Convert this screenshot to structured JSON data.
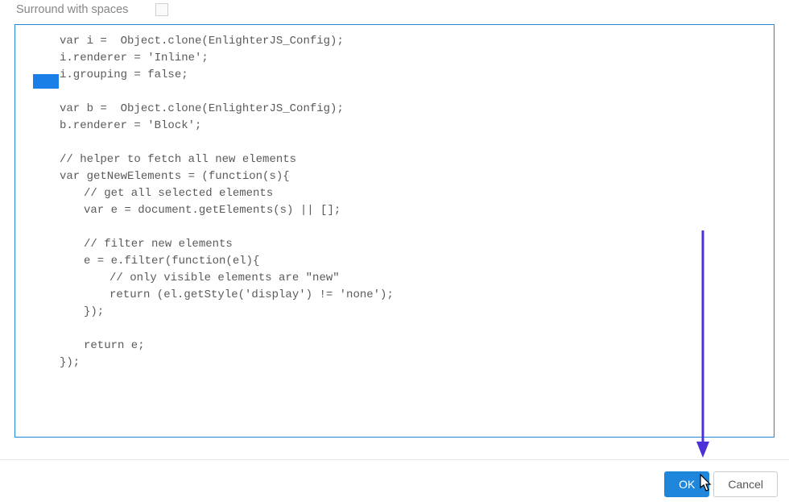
{
  "option": {
    "label": "Surround with spaces",
    "checked": false
  },
  "code": {
    "lines": [
      {
        "text": "var i =  Object.clone(EnlighterJS_Config);",
        "indent": 0
      },
      {
        "text": "i.renderer = 'Inline';",
        "indent": 0
      },
      {
        "text": "i.grouping = false;",
        "indent": 0
      },
      {
        "text": "",
        "indent": 0
      },
      {
        "text": "var b =  Object.clone(EnlighterJS_Config);",
        "indent": 0
      },
      {
        "text": "b.renderer = 'Block';",
        "indent": 0
      },
      {
        "text": "",
        "indent": 0
      },
      {
        "text": "// helper to fetch all new elements",
        "indent": 0
      },
      {
        "text": "var getNewElements = (function(s){",
        "indent": 0
      },
      {
        "text": "// get all selected elements",
        "indent": 1
      },
      {
        "text": "var e = document.getElements(s) || [];",
        "indent": 1
      },
      {
        "text": "",
        "indent": 1
      },
      {
        "text": "// filter new elements",
        "indent": 1
      },
      {
        "text": "e = e.filter(function(el){",
        "indent": 1
      },
      {
        "text": "// only visible elements are \"new\"",
        "indent": 2
      },
      {
        "text": "return (el.getStyle('display') != 'none');",
        "indent": 2
      },
      {
        "text": "});",
        "indent": 1
      },
      {
        "text": "",
        "indent": 1
      },
      {
        "text": "return e;",
        "indent": 1
      },
      {
        "text": "});",
        "indent": 0
      }
    ]
  },
  "buttons": {
    "ok": "OK",
    "cancel": "Cancel"
  },
  "annotation": {
    "arrow_color": "#4d30d8"
  }
}
